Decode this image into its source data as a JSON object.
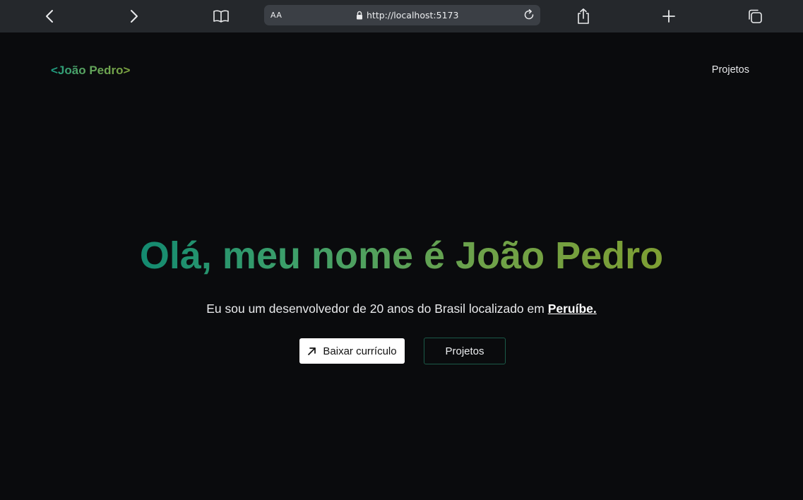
{
  "browser": {
    "aa_label": "AA",
    "url": "http://localhost:5173"
  },
  "nav": {
    "logo": "<João Pedro>",
    "projetos_link": "Projetos"
  },
  "hero": {
    "title": "Olá, meu nome é João Pedro",
    "subtitle_prefix": "Eu sou um desenvolvedor de 20 anos do Brasil localizado em ",
    "subtitle_location": "Peruíbe.",
    "download_button": "Baixar currículo",
    "projects_button": "Projetos"
  },
  "colors": {
    "page_background": "#0a0b0d",
    "browser_toolbar": "#25282c",
    "gradient_start": "#138a70",
    "gradient_end": "#7e9e33",
    "outline_button_border": "#1b5a48"
  },
  "icons": [
    "back-icon",
    "forward-icon",
    "reader-book-icon",
    "lock-icon",
    "reload-icon",
    "share-icon",
    "plus-icon",
    "tabs-icon",
    "arrow-up-right-icon"
  ]
}
